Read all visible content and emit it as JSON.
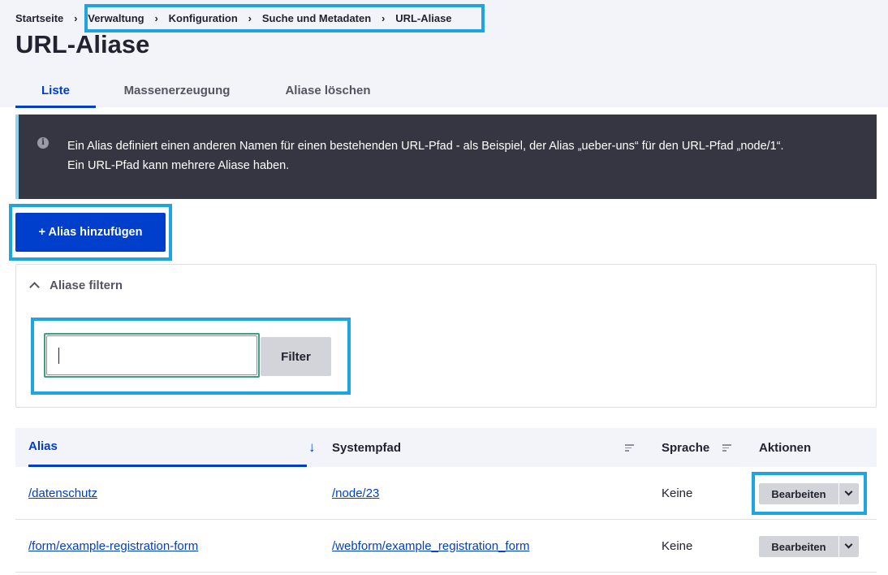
{
  "breadcrumb": {
    "items": [
      "Startseite",
      "Verwaltung",
      "Konfiguration",
      "Suche und Metadaten",
      "URL-Aliase"
    ],
    "separator": "›"
  },
  "page_title": "URL-Aliase",
  "tabs": [
    {
      "label": "Liste",
      "active": true
    },
    {
      "label": "Massenerzeugung",
      "active": false
    },
    {
      "label": "Aliase löschen",
      "active": false
    }
  ],
  "message": {
    "icon": "info-icon",
    "line1": "Ein Alias definiert einen anderen Namen für einen bestehenden URL-Pfad - als Beispiel, der Alias „ueber-uns“ für den URL-Pfad „node/1“.",
    "line2": "Ein URL-Pfad kann mehrere Aliase haben."
  },
  "add_button": "+ Alias hinzufügen",
  "filter": {
    "summary": "Aliase filtern",
    "input_value": "",
    "button": "Filter"
  },
  "table": {
    "headers": {
      "alias": "Alias",
      "system_path": "Systempfad",
      "language": "Sprache",
      "actions": "Aktionen"
    },
    "rows": [
      {
        "alias": "/datenschutz",
        "system_path": "/node/23",
        "language": "Keine",
        "edit": "Bearbeiten"
      },
      {
        "alias": "/form/example-registration-form",
        "system_path": "/webform/example_registration_form",
        "language": "Keine",
        "edit": "Bearbeiten"
      }
    ]
  },
  "colors": {
    "primary": "#003ecc",
    "highlight": "#1ea4df",
    "message_bg": "#353641",
    "header_bg": "#f3f4f9"
  }
}
